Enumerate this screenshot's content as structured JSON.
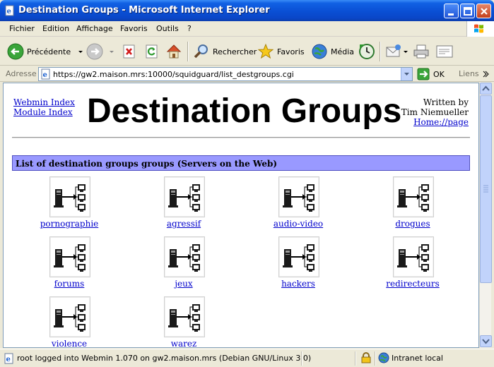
{
  "window": {
    "title": "Destination Groups - Microsoft Internet Explorer"
  },
  "menu": {
    "items": [
      "Fichier",
      "Edition",
      "Affichage",
      "Favoris",
      "Outils",
      "?"
    ]
  },
  "toolbar": {
    "back_label": "Précédente",
    "search_label": "Rechercher",
    "favorites_label": "Favoris",
    "media_label": "Média"
  },
  "address": {
    "label": "Adresse",
    "url": "https://gw2.maison.mrs:10000/squidguard/list_destgroups.cgi",
    "go_label": "OK",
    "links_label": "Liens"
  },
  "page": {
    "webmin_index": "Webmin Index",
    "module_index": "Module Index",
    "title": "Destination Groups",
    "written_by": "Written by",
    "author": "Tim Niemueller",
    "homepage": "Home://page",
    "section_header": "List of destination groups groups (Servers on the Web)",
    "groups": [
      "pornographie",
      "agressif",
      "audio-video",
      "drogues",
      "forums",
      "jeux",
      "hackers",
      "redirecteurs",
      "violence",
      "warez"
    ]
  },
  "status": {
    "text": "root logged into Webmin 1.070 on gw2.maison.mrs (Debian GNU/Linux 3.0)",
    "zone": "Intranet local"
  },
  "colors": {
    "title_bar": "#0a4fd4",
    "section_header_bg": "#9999ff",
    "link": "#0000cc"
  }
}
